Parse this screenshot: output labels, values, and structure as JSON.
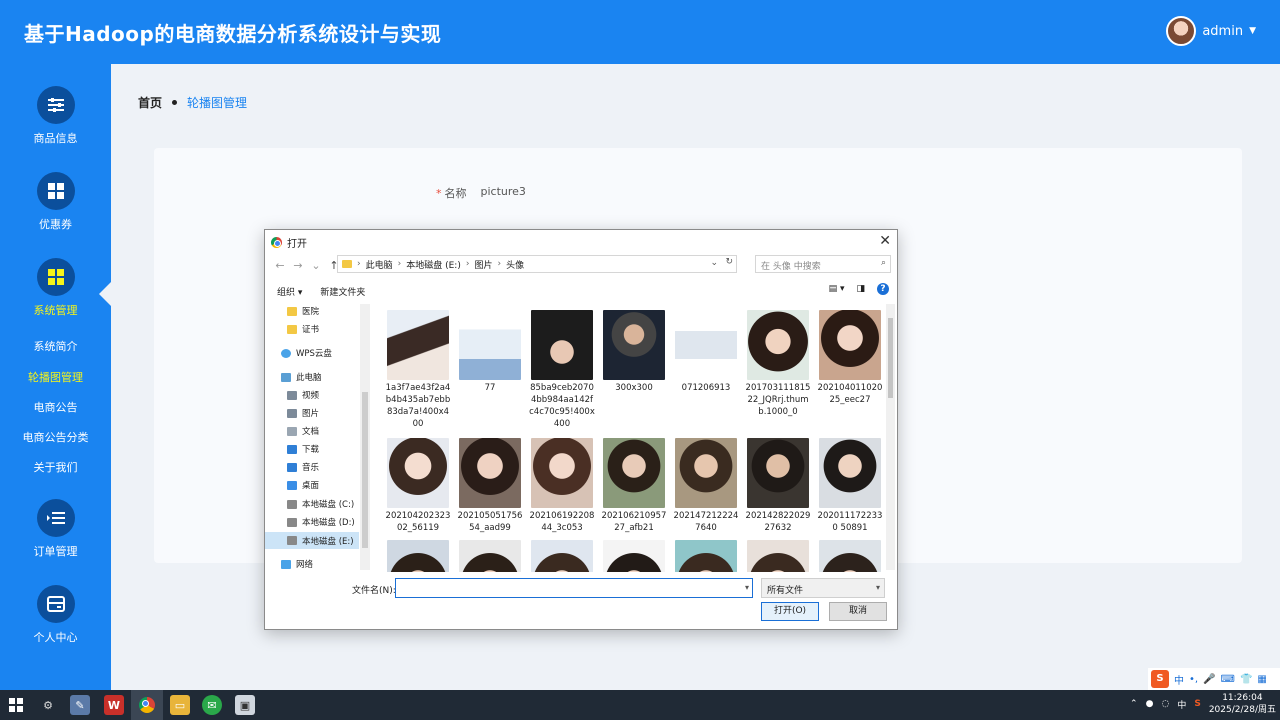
{
  "header": {
    "title": "基于Hadoop的电商数据分析系统设计与实现",
    "user": "admin"
  },
  "sidebar": {
    "items": [
      {
        "label": "商品信息",
        "icon": "sliders-icon"
      },
      {
        "label": "优惠券",
        "icon": "grid-icon"
      },
      {
        "label": "系统管理",
        "icon": "grid-icon"
      },
      {
        "label": "订单管理",
        "icon": "list-icon"
      },
      {
        "label": "个人中心",
        "icon": "card-icon"
      }
    ],
    "subitems": [
      "系统简介",
      "轮播图管理",
      "电商公告",
      "电商公告分类",
      "关于我们"
    ]
  },
  "breadcrumb": {
    "home": "首页",
    "current": "轮播图管理"
  },
  "form": {
    "name_label": "名称",
    "name_value": "picture3"
  },
  "dialog": {
    "title": "打开",
    "path": [
      "此电脑",
      "本地磁盘 (E:)",
      "图片",
      "头像"
    ],
    "search_placeholder": "在 头像 中搜索",
    "organize": "组织",
    "new_folder": "新建文件夹",
    "tree": [
      "医院",
      "证书",
      "WPS云盘",
      "此电脑",
      "视频",
      "图片",
      "文档",
      "下载",
      "音乐",
      "桌面",
      "本地磁盘 (C:)",
      "本地磁盘 (D:)",
      "本地磁盘 (E:)",
      "网络"
    ],
    "files": [
      "1a3f7ae43f2a4b4b435ab7ebb83da7a!400x400",
      "77",
      "85ba9ceb20704bb984aa142fc4c70c95!400x400",
      "300x300",
      "071206913",
      "20170311181522_JQRrj.thumb.1000_0",
      "20210401102025_eec27",
      "20210420232302_56119",
      "20210505175654_aad99",
      "20210619220844_3c053",
      "20210621095727_afb21",
      "2021472122247640",
      "20214282202927632",
      "2020111722330 50891",
      "",
      "",
      "",
      "",
      "",
      "",
      ""
    ],
    "filename_label": "文件名(N):",
    "filename_value": "",
    "filetype": "所有文件",
    "open_button": "打开(O)",
    "cancel_button": "取消"
  },
  "ime": {
    "mode": "中"
  },
  "taskbar": {
    "time": "11:26:04",
    "date": "2025/2/28/周五",
    "lang": "中"
  }
}
